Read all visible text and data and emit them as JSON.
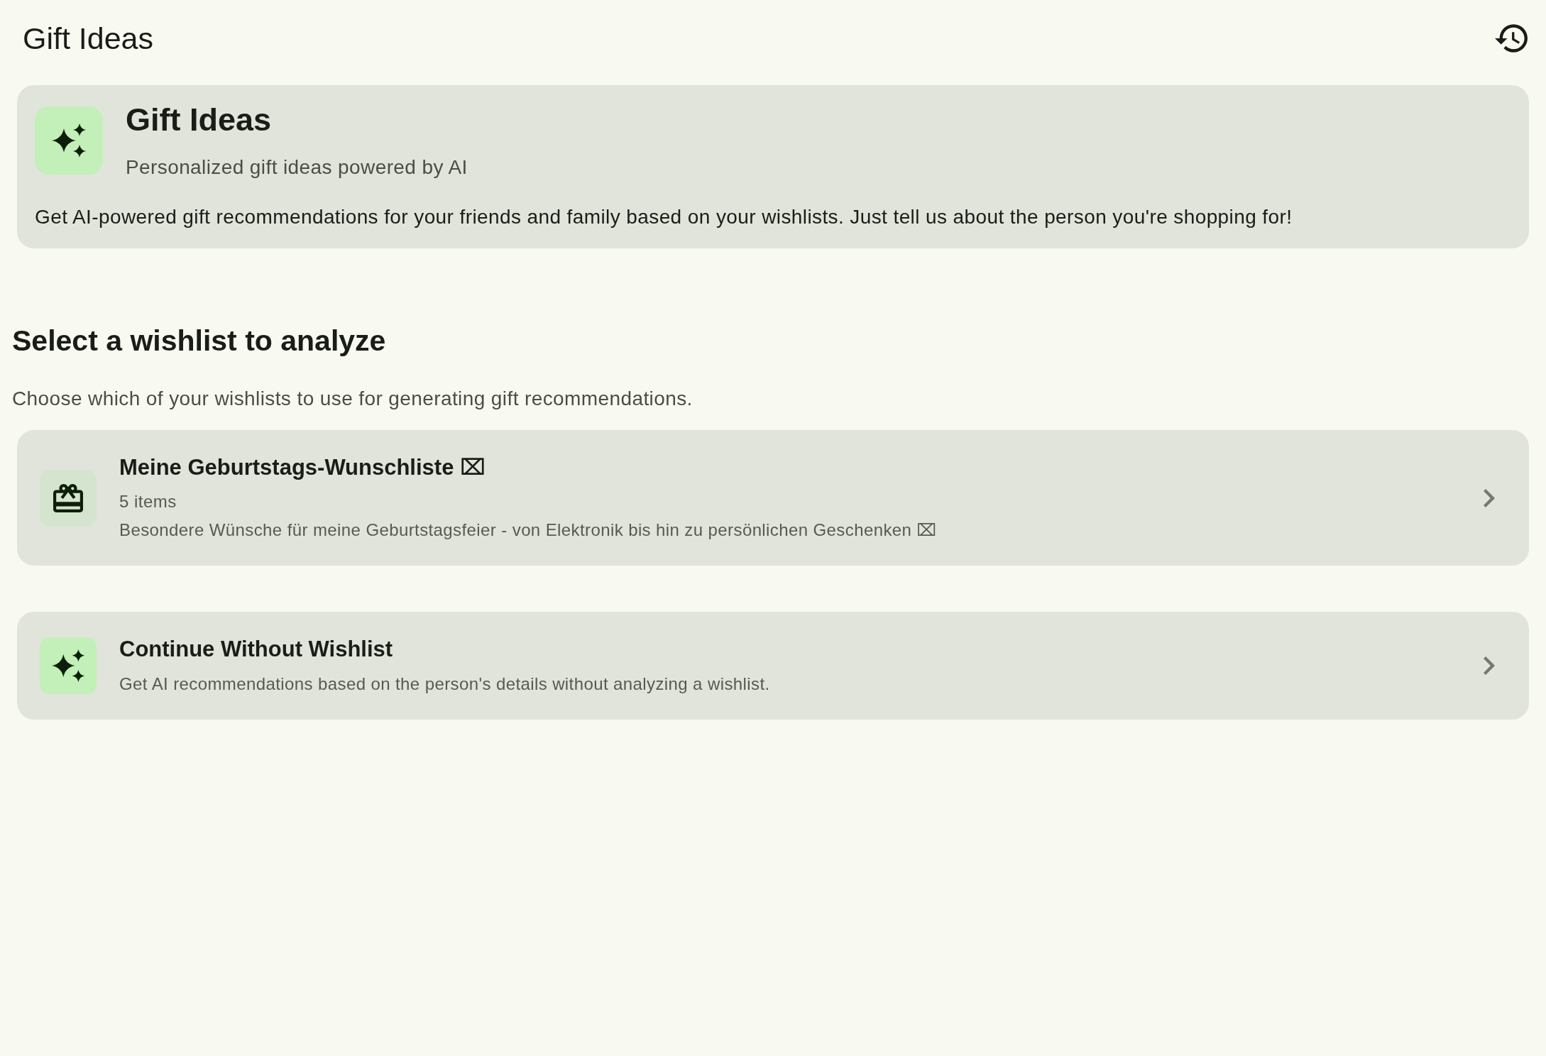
{
  "app_bar": {
    "title": "Gift Ideas"
  },
  "intro_card": {
    "title": "Gift Ideas",
    "subtitle": "Personalized gift ideas powered by AI",
    "description": "Get AI-powered gift recommendations for your friends and family based on your wishlists. Just tell us about the person you're shopping for!"
  },
  "section": {
    "heading": "Select a wishlist to analyze",
    "description": "Choose which of your wishlists to use for generating gift recommendations."
  },
  "options": [
    {
      "kind": "wishlist",
      "title": "Meine Geburtstags-Wunschliste ⌧",
      "count": "5 items",
      "description": "Besondere Wünsche für meine Geburtstagsfeier - von Elektronik bis hin zu persönlichen Geschenken ⌧"
    },
    {
      "kind": "no_wishlist",
      "title": "Continue Without Wishlist",
      "description": "Get AI recommendations based on the person's details without analyzing a wishlist."
    }
  ]
}
